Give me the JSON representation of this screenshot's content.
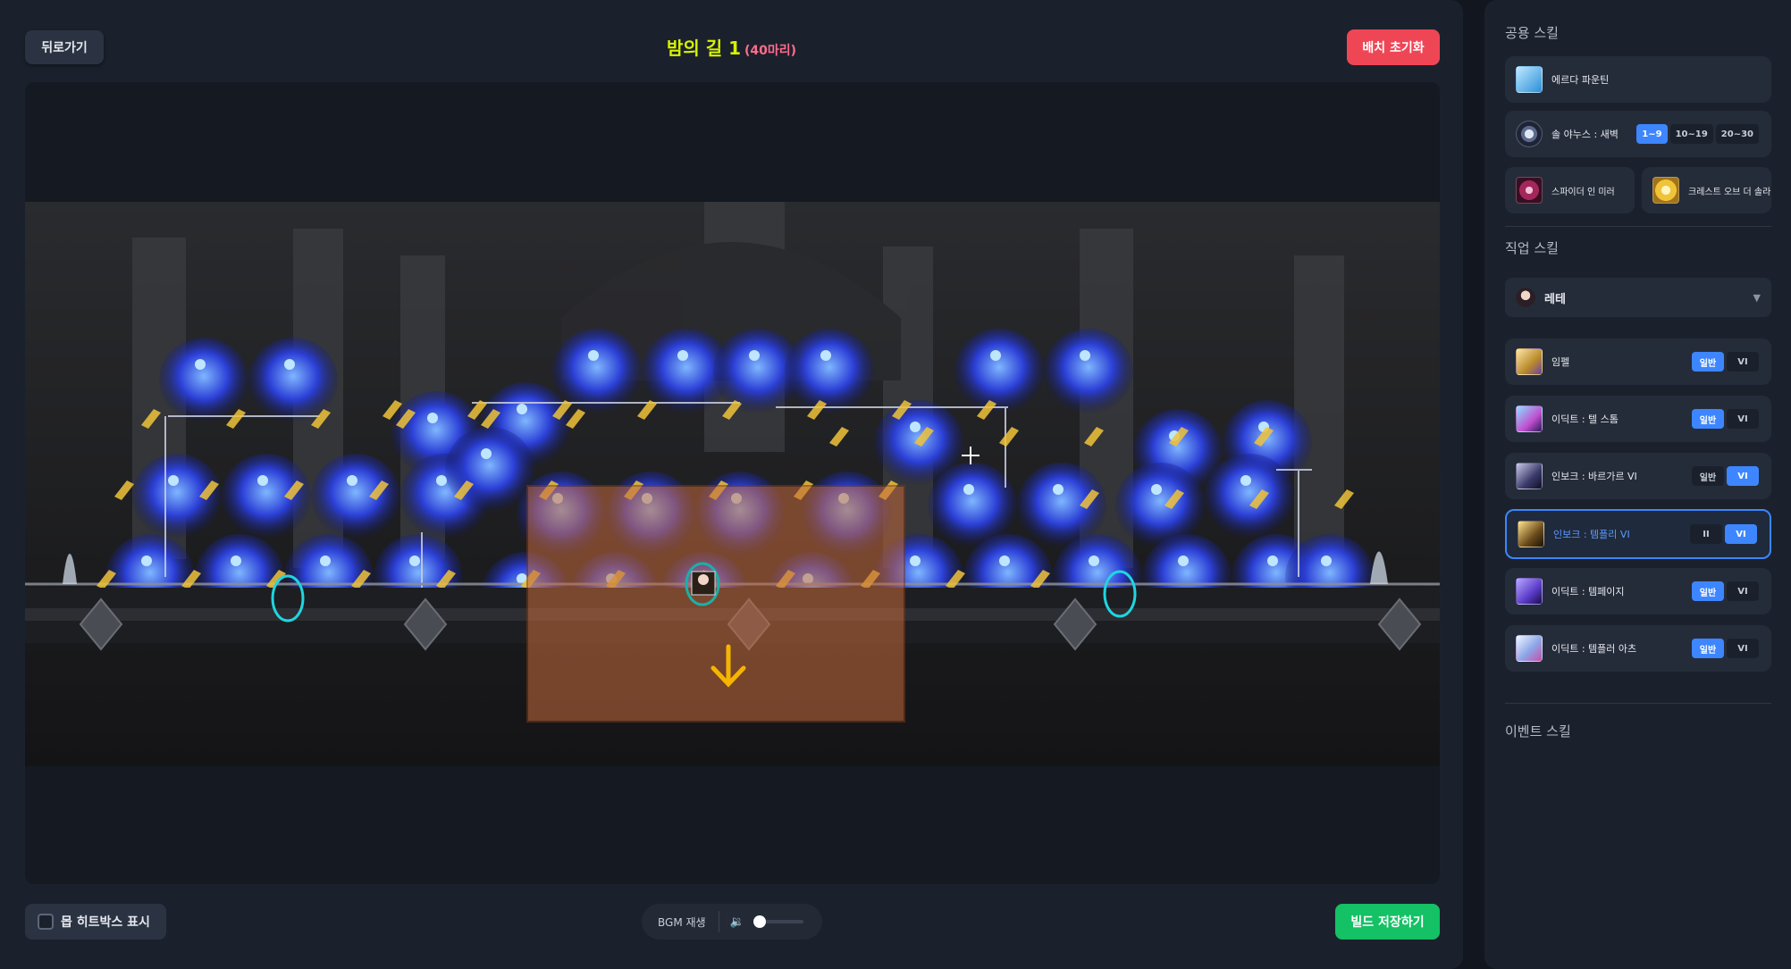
{
  "header": {
    "back_label": "뒤로가기",
    "title": "밤의 길 1",
    "count": "(40마리)",
    "reset_label": "배치 초기화"
  },
  "footer": {
    "hitbox_label": "몹 히트박스 표시",
    "bgm_label": "BGM 재생",
    "volume_level": 0,
    "save_label": "빌드 저장하기"
  },
  "sidebar": {
    "common_title": "공용 스킬",
    "common_skills": [
      {
        "label": "에르다 파운틴",
        "icon": "erda-fountain-icon"
      },
      {
        "label": "솔 야누스 : 새벽",
        "icon": "sol-janus-icon",
        "options": [
          "1~9",
          "10~19",
          "20~30"
        ],
        "selected": "1~9"
      },
      {
        "label": "스파이더 인 미러",
        "icon": "spider-in-mirror-icon"
      },
      {
        "label": "크레스트 오브 더 솔라",
        "icon": "crest-of-the-solar-icon"
      }
    ],
    "job_title": "직업 스킬",
    "job_selected": "레테",
    "job_skills": [
      {
        "label": "임펠",
        "options": [
          "일반",
          "VI"
        ],
        "selected": "일반"
      },
      {
        "label": "이딕트 : 텔 스톰",
        "options": [
          "일반",
          "VI"
        ],
        "selected": "일반"
      },
      {
        "label": "인보크 : 바르가르 VI",
        "options": [
          "일반",
          "VI"
        ],
        "selected": "VI"
      },
      {
        "label": "인보크 : 템플리 VI",
        "options": [
          "II",
          "VI"
        ],
        "selected": "VI",
        "active": true
      },
      {
        "label": "이딕트 : 템페이지",
        "options": [
          "일반",
          "VI"
        ],
        "selected": "일반"
      },
      {
        "label": "이딕트 : 템플러 아츠",
        "options": [
          "일반",
          "VI"
        ],
        "selected": "일반"
      }
    ],
    "event_title": "이벤트 스킬"
  },
  "colors": {
    "accent_blue": "#3d86ff",
    "reset_red": "#ef4656",
    "save_green": "#14c165",
    "title_yellow": "#d7f200",
    "count_pink": "#ff6c8d",
    "mob_blue": "#2b3fd6",
    "rune_gold": "#f0c33a",
    "selection_orange": "#c66a3c",
    "portal_cyan": "#1fd6e0"
  }
}
